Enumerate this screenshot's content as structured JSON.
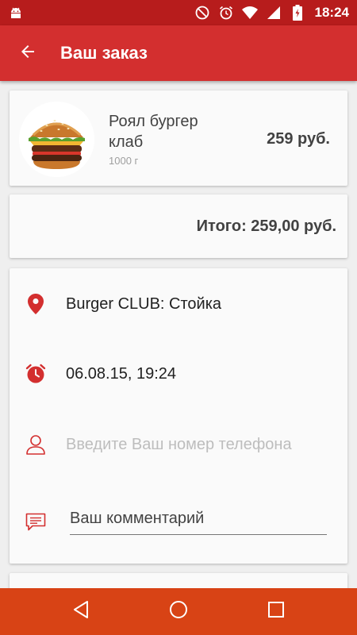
{
  "status_bar": {
    "time": "18:24",
    "icons": [
      "android-icon",
      "do-not-disturb-icon",
      "alarm-icon",
      "wifi-icon",
      "signal-icon",
      "battery-charging-icon"
    ]
  },
  "app_bar": {
    "title": "Ваш заказ",
    "back_icon": "arrow-back-icon"
  },
  "order_item": {
    "name": "Роял бургер клаб",
    "weight": "1000 г",
    "price": "259 руб.",
    "image": "burger-image"
  },
  "total": {
    "text": "Итого: 259,00 руб."
  },
  "details": {
    "location": "Burger CLUB: Стойка",
    "datetime": "06.08.15, 19:24",
    "phone_placeholder": "Введите Ваш номер телефона",
    "phone_value": "",
    "comment_placeholder": "Ваш комментарий",
    "comment_value": ""
  },
  "nav_bar": {
    "buttons": [
      "back-triangle-icon",
      "home-circle-icon",
      "recents-square-icon"
    ]
  },
  "colors": {
    "status_bar": "#b71c1c",
    "app_bar": "#d32f2f",
    "accent": "#d32f2f",
    "nav_bar": "#d84315",
    "background": "#efefef",
    "card": "#fafafa"
  }
}
